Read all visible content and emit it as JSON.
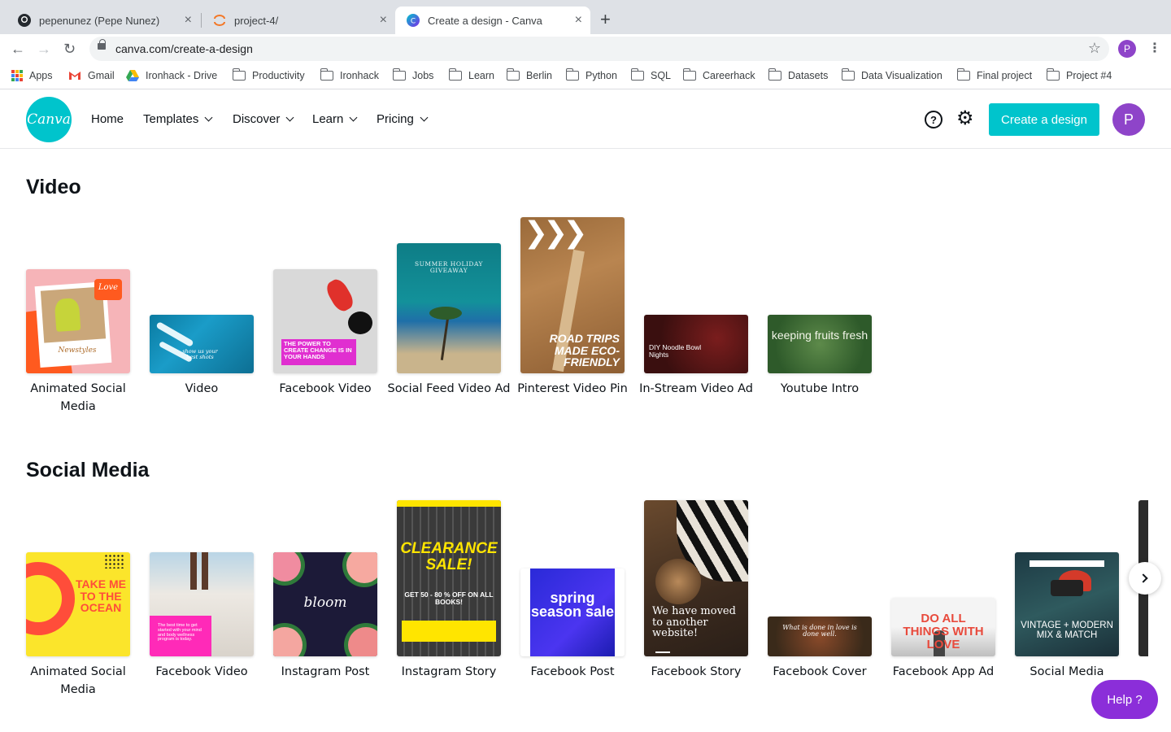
{
  "browser": {
    "tabs": [
      {
        "title": "pepenunez (Pepe Nunez)",
        "icon": "github-icon"
      },
      {
        "title": "project-4/",
        "icon": "jupyter-icon"
      },
      {
        "title": "Create a design - Canva",
        "icon": "canva-icon"
      }
    ],
    "url": "canva.com/create-a-design",
    "profile_initial": "P",
    "bookmarks": [
      "Apps",
      "Gmail",
      "Ironhack - Drive",
      "Productivity",
      "Ironhack",
      "Jobs",
      "Learn",
      "Berlin",
      "Python",
      "SQL",
      "Careerhack",
      "Datasets",
      "Data Visualization",
      "Final project",
      "Project #4"
    ]
  },
  "header": {
    "logo_text": "Canva",
    "nav": [
      "Home",
      "Templates",
      "Discover",
      "Learn",
      "Pricing"
    ],
    "create_label": "Create a design",
    "avatar_initial": "P",
    "accent": "#00c4cc",
    "avatar_color": "#8e44c9"
  },
  "sections": [
    {
      "title": "Video",
      "cards": [
        {
          "label": "Animated Social Media",
          "thumb_text": "Love",
          "thumb_text2": "Newstyles"
        },
        {
          "label": "Video",
          "thumb_text": "show us your best shots"
        },
        {
          "label": "Facebook Video",
          "thumb_text": "THE POWER TO CREATE CHANGE IS IN YOUR HANDS"
        },
        {
          "label": "Social Feed Video Ad",
          "thumb_text": "SUMMER HOLIDAY GIVEAWAY"
        },
        {
          "label": "Pinterest Video Pin",
          "thumb_text": "ROAD TRIPS MADE ECO-FRIENDLY"
        },
        {
          "label": "In-Stream Video Ad",
          "thumb_text": "DIY Noodle Bowl Nights"
        },
        {
          "label": "Youtube Intro",
          "thumb_text": "keeping fruits fresh"
        }
      ]
    },
    {
      "title": "Social Media",
      "cards": [
        {
          "label": "Animated Social Media",
          "thumb_text": "TAKE ME TO THE OCEAN"
        },
        {
          "label": "Facebook Video",
          "thumb_text": "The best time to get started with your mind and body wellness program is today."
        },
        {
          "label": "Instagram Post",
          "thumb_text": "bloom"
        },
        {
          "label": "Instagram Story",
          "thumb_text": "CLEARANCE SALE!",
          "thumb_text2": "GET 50 - 80 % OFF ON ALL BOOKS!"
        },
        {
          "label": "Facebook Post",
          "thumb_text": "spring season sale"
        },
        {
          "label": "Facebook Story",
          "thumb_text": "We have moved to another website!"
        },
        {
          "label": "Facebook Cover",
          "thumb_text": "What is done in love is done well."
        },
        {
          "label": "Facebook App Ad",
          "thumb_text": "DO ALL THINGS WITH LOVE"
        },
        {
          "label": "Social Media",
          "thumb_text": "VINTAGE + MODERN MIX & MATCH"
        }
      ]
    }
  ],
  "help_label": "Help  ?"
}
